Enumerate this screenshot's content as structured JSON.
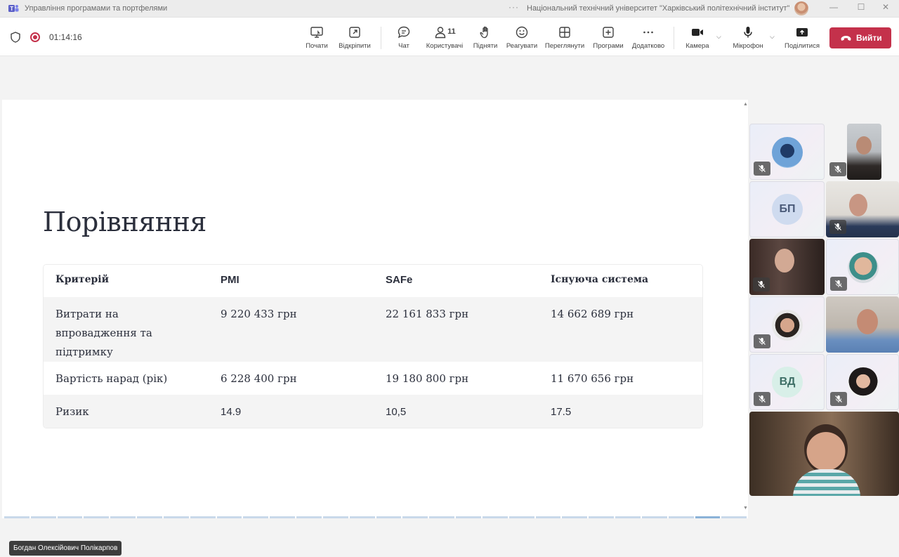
{
  "window": {
    "title": "Управління програмами та портфелями",
    "more_glyph": "···",
    "organization": "Національний технічний університет \"Харківський політехнічний інститут\"",
    "minimize": "—",
    "maximize": "☐",
    "close": "✕"
  },
  "toolbar": {
    "timer": "01:14:16",
    "people_count": "11",
    "buttons": {
      "share_start": "Почати",
      "popout": "Відкріпити",
      "chat": "Чат",
      "people": "Користувачі",
      "raise": "Підняти",
      "react": "Реагувати",
      "view": "Переглянути",
      "apps": "Програми",
      "more": "Додатково",
      "camera": "Камера",
      "mic": "Мікрофон",
      "share": "Поділитися"
    },
    "leave": "Вийти",
    "icons": [
      "shield-icon",
      "record-icon",
      "share-screen-icon",
      "popout-icon",
      "chat-icon",
      "people-icon",
      "hand-icon",
      "smiley-icon",
      "grid-view-icon",
      "apps-plus-icon",
      "more-dots-icon",
      "camera-icon",
      "microphone-icon",
      "share-tray-icon",
      "phone-hangup-icon"
    ]
  },
  "slide": {
    "title": "Порівняння",
    "table": {
      "headers": [
        "Критерій",
        "PMI",
        "SAFe",
        "Існуюча система"
      ],
      "rows": [
        [
          "Витрати на впровадження та підтримку",
          "9 220 433 грн",
          "22 161 833 грн",
          "14 662 689 грн"
        ],
        [
          "Вартість нарад (рік)",
          "6 228 400 грн",
          "19 180 800 грн",
          "11 670 656 грн"
        ],
        [
          "Ризик",
          "14.9",
          "10,5",
          "17.5"
        ]
      ]
    }
  },
  "participants": {
    "initials": [
      "БП",
      "ВД"
    ],
    "presenter_name": "Богдан Олексійович Полікарпов"
  },
  "colors": {
    "accent_leave": "#c4314b",
    "toolbar_bg": "#ffffff",
    "slide_bg": "#ffffff",
    "row_shade": "#f4f4f4",
    "progress": "#c9d9ea"
  }
}
